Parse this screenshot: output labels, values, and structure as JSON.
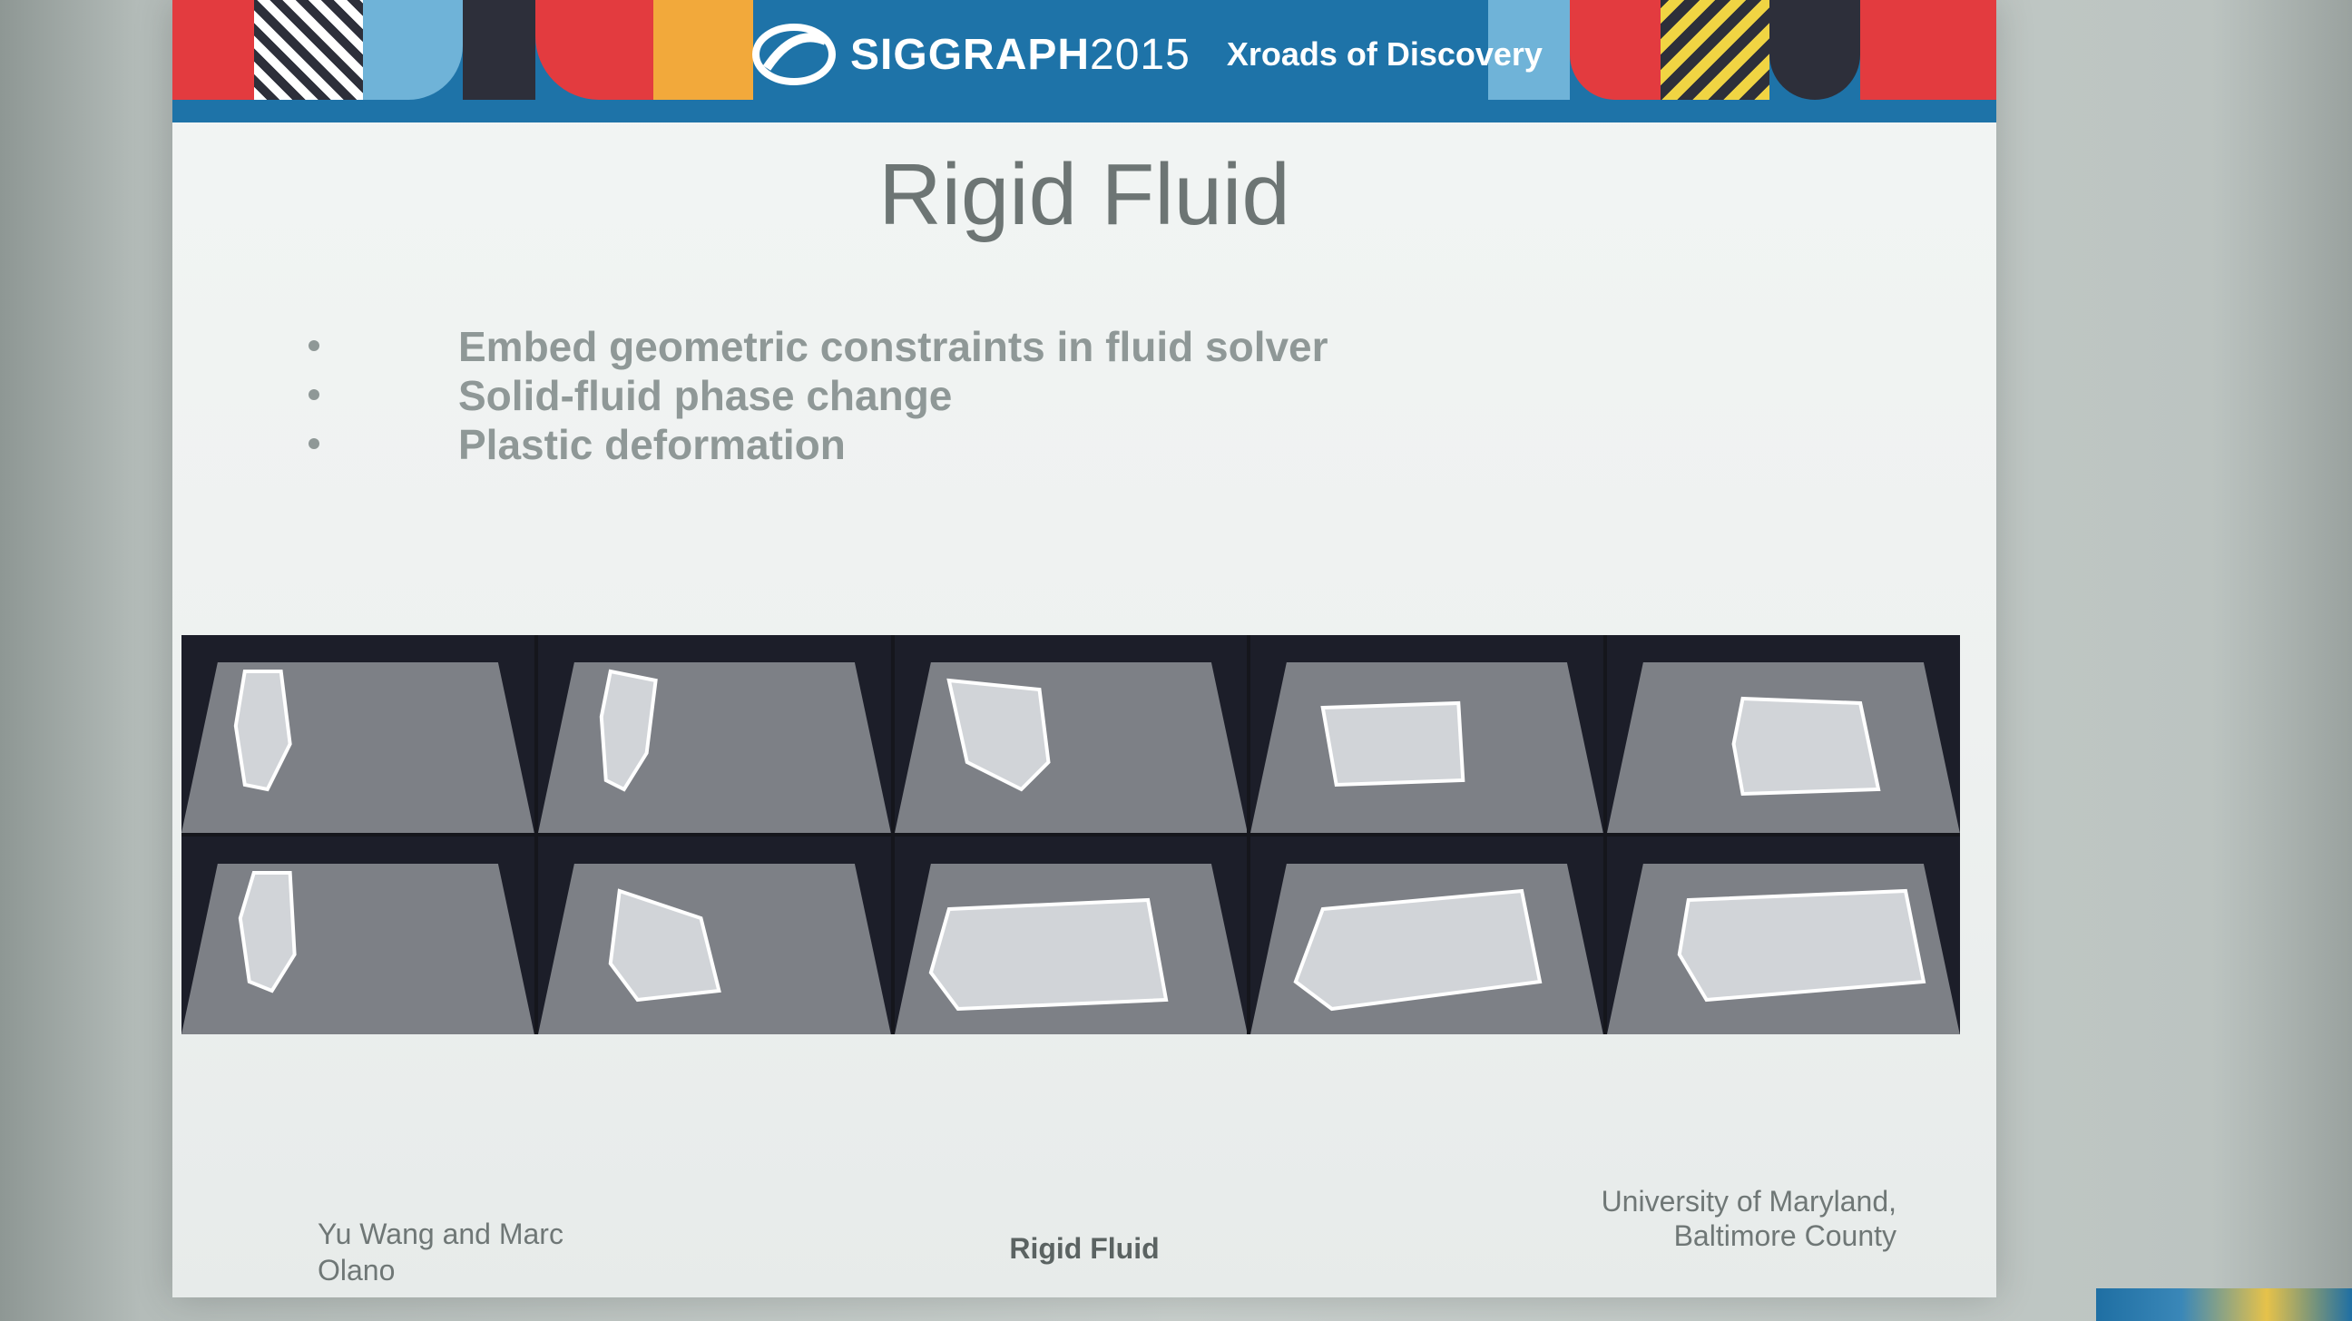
{
  "banner": {
    "logo_text": "SIGGRAPH",
    "logo_year": "2015",
    "tagline": "Xroads of Discovery",
    "colors": [
      "#1e73a8",
      "#e33b3f",
      "#f2a93b",
      "#2d2f3a",
      "#6fb3d8",
      "#f0d443"
    ]
  },
  "slide": {
    "title": "Rigid Fluid",
    "bullets": [
      "Embed geometric constraints in fluid solver",
      "Solid-fluid phase change",
      "Plastic deformation"
    ]
  },
  "footer": {
    "authors": "Yu Wang and Marc Olano",
    "center": "Rigid Fluid",
    "university": "University of Maryland, Baltimore County"
  }
}
